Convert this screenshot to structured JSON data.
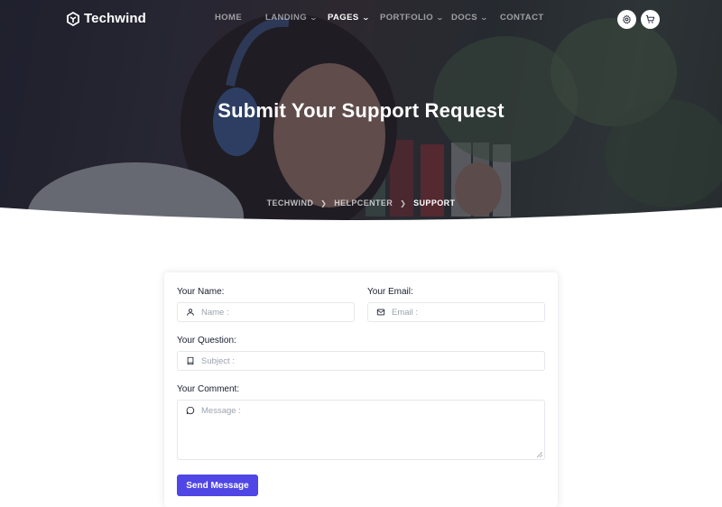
{
  "brand": {
    "name": "Techwind"
  },
  "nav": {
    "items": [
      {
        "label": "HOME",
        "has_dropdown": false,
        "active": false
      },
      {
        "label": "LANDING",
        "has_dropdown": true,
        "active": false
      },
      {
        "label": "PAGES",
        "has_dropdown": true,
        "active": true
      },
      {
        "label": "PORTFOLIO",
        "has_dropdown": true,
        "active": false
      },
      {
        "label": "DOCS",
        "has_dropdown": true,
        "active": false
      },
      {
        "label": "CONTACT",
        "has_dropdown": false,
        "active": false
      }
    ],
    "icons": [
      "settings-icon",
      "cart-icon"
    ]
  },
  "hero": {
    "title": "Submit Your Support Request",
    "breadcrumb": [
      "TECHWIND",
      "HELPCENTER",
      "SUPPORT"
    ]
  },
  "form": {
    "name_label": "Your Name:",
    "name_placeholder": "Name :",
    "email_label": "Your Email:",
    "email_placeholder": "Email :",
    "question_label": "Your Question:",
    "question_placeholder": "Subject :",
    "comment_label": "Your Comment:",
    "comment_placeholder": "Message :",
    "submit_label": "Send Message"
  },
  "colors": {
    "accent": "#4f46e5",
    "text": "#161c2d",
    "placeholder": "#9ca3af",
    "border": "#e5e7eb"
  }
}
